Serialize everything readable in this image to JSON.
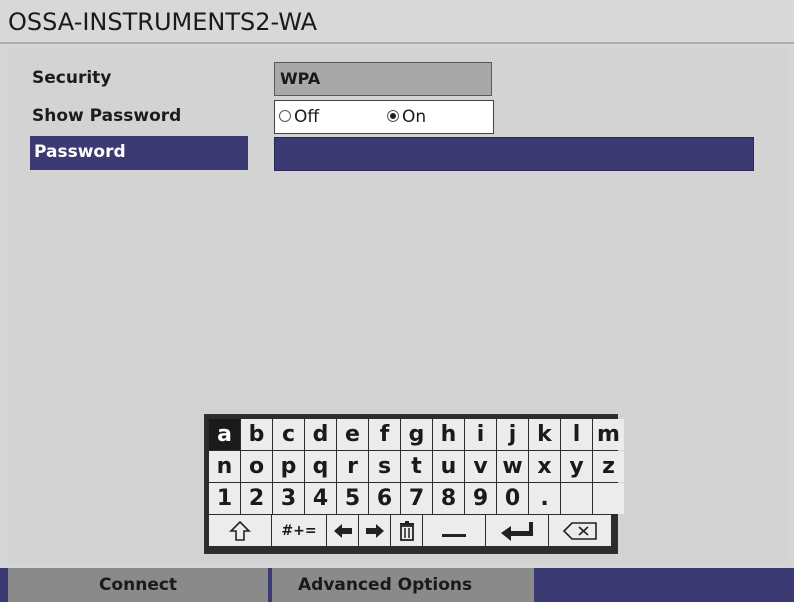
{
  "window": {
    "title": "OSSA-INSTRUMENTS2-WA"
  },
  "form": {
    "security": {
      "label": "Security",
      "value": "WPA"
    },
    "show_password": {
      "label": "Show Password",
      "options": [
        {
          "label": "Off",
          "selected": false
        },
        {
          "label": "On",
          "selected": true
        }
      ]
    },
    "password": {
      "label": "Password",
      "value": ""
    }
  },
  "keyboard": {
    "rows": [
      [
        "a",
        "b",
        "c",
        "d",
        "e",
        "f",
        "g",
        "h",
        "i",
        "j",
        "k",
        "l",
        "m"
      ],
      [
        "n",
        "o",
        "p",
        "q",
        "r",
        "s",
        "t",
        "u",
        "v",
        "w",
        "x",
        "y",
        "z"
      ],
      [
        "1",
        "2",
        "3",
        "4",
        "5",
        "6",
        "7",
        "8",
        "9",
        "0",
        ".",
        "",
        ""
      ]
    ],
    "selected_key": "a",
    "special": {
      "shift": "shift-icon",
      "symbols_label": "#+=",
      "left": "arrow-left-icon",
      "right": "arrow-right-icon",
      "delete_all": "trash-icon",
      "space": "space-icon",
      "enter": "enter-icon",
      "backspace": "backspace-icon"
    }
  },
  "bottom_bar": {
    "connect_label": "Connect",
    "advanced_label": "Advanced Options"
  },
  "colors": {
    "highlight": "#3c3a72",
    "background": "#d3d3d3",
    "button": "#8a8a8a"
  }
}
